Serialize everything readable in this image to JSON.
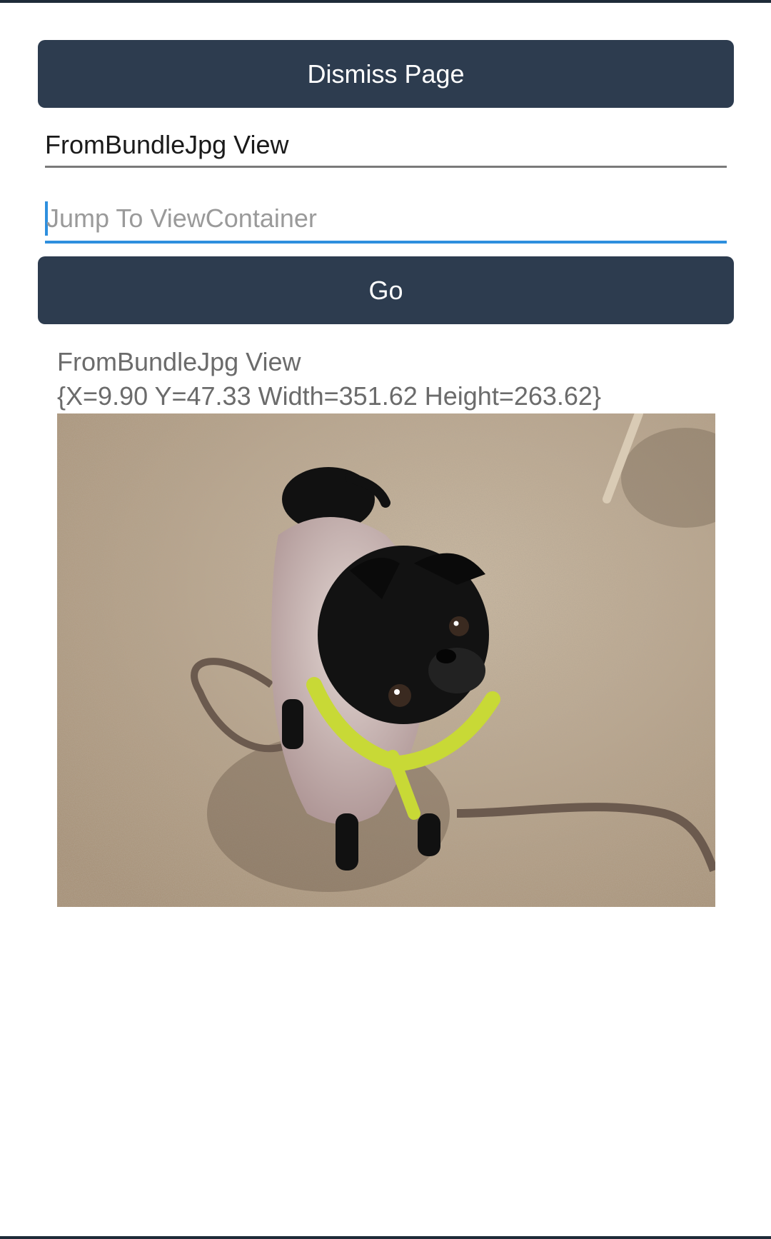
{
  "page": {
    "dismiss_button_label": "Dismiss Page",
    "title_entry_value": "FromBundleJpg View",
    "jump_entry_placeholder": "Jump To ViewContainer",
    "go_button_label": "Go",
    "view_label": "FromBundleJpg View",
    "bounds_label": "{X=9.90 Y=47.33 Width=351.62 Height=263.62}",
    "image_alt": "black pug wearing a knitted sweater and yellow harness on carpet"
  },
  "colors": {
    "button_bg": "#2d3c4f",
    "button_text": "#ffffff",
    "focus_underline": "#2e8fde",
    "placeholder_text": "#9a9a9a"
  }
}
